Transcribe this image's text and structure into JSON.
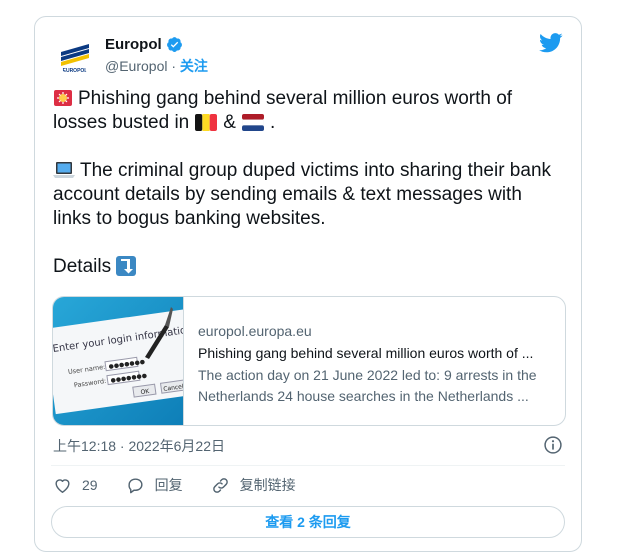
{
  "tweet": {
    "display_name": "Europol",
    "handle": "@Europol",
    "separator": " · ",
    "follow_label": "关注",
    "logo_text": "EUROPOL",
    "line1_text": "Phishing gang behind several million euros worth of losses busted in",
    "line1_amp": "&",
    "line1_end": ".",
    "para2": "The criminal group duped victims into sharing their bank account details by sending emails & text messages with links to bogus banking websites.",
    "details": "Details",
    "icons": {
      "siren": "police-light-emoji",
      "laptop": "laptop-emoji",
      "arrow": "arrow-down-emoji",
      "flag1": "belgium-flag",
      "flag2": "netherlands-flag"
    },
    "colors": {
      "accent": "#1d9bf0",
      "text": "#0f1419",
      "muted": "#536471",
      "border": "#cfd9de"
    }
  },
  "link_card": {
    "domain": "europol.europa.eu",
    "title": "Phishing gang behind several million euros worth of ...",
    "description": "The action day on 21 June 2022 led to: 9 arrests in the Netherlands 24 house searches in the Netherlands ...",
    "thumb_text": {
      "heading": "Enter your login information:",
      "user_label": "User name:",
      "password_label": "Password:",
      "ok": "OK",
      "cancel": "Cancel"
    }
  },
  "meta": {
    "timestamp": "上午12:18 · 2022年6月22日"
  },
  "actions": {
    "like_count": "29",
    "reply_label": "回复",
    "copy_link_label": "复制链接"
  },
  "footer": {
    "view_replies": "查看 2 条回复"
  }
}
